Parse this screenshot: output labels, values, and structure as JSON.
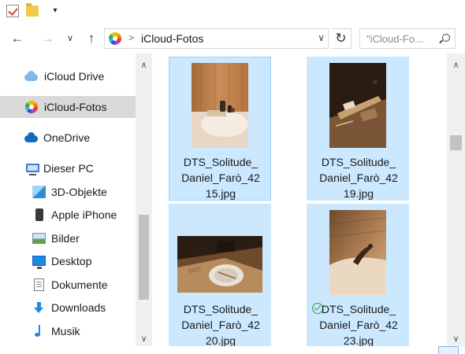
{
  "toolbar": {
    "quick_access": [
      {
        "icon": "properties-check-icon"
      },
      {
        "icon": "new-folder-icon"
      },
      {
        "icon": "customize-dropdown-icon",
        "glyph": "▾"
      }
    ]
  },
  "navigation": {
    "back_glyph": "←",
    "forward_glyph": "→",
    "recent_glyph": "∨",
    "up_glyph": "↑",
    "address": {
      "icon": "icloud-photos-icon",
      "separator": ">",
      "path": "iCloud-Fotos",
      "dropdown_glyph": "∨"
    },
    "refresh_glyph": "↻",
    "search_placeholder": "\"iCloud-Fo..."
  },
  "sidebar": {
    "items": [
      {
        "label": "iCloud Drive",
        "icon": "icloud-drive-icon",
        "selected": false
      },
      {
        "label": "iCloud-Fotos",
        "icon": "icloud-photos-icon",
        "selected": true
      },
      {
        "label": "OneDrive",
        "icon": "onedrive-cloud-icon",
        "selected": false
      },
      {
        "label": "Dieser PC",
        "icon": "this-pc-icon",
        "selected": false
      },
      {
        "label": "3D-Objekte",
        "icon": "3d-objects-icon",
        "selected": false
      },
      {
        "label": "Apple iPhone",
        "icon": "iphone-icon",
        "selected": false
      },
      {
        "label": "Bilder",
        "icon": "pictures-icon",
        "selected": false
      },
      {
        "label": "Desktop",
        "icon": "desktop-icon",
        "selected": false
      },
      {
        "label": "Dokumente",
        "icon": "documents-icon",
        "selected": false
      },
      {
        "label": "Downloads",
        "icon": "downloads-icon",
        "selected": false
      },
      {
        "label": "Musik",
        "icon": "music-icon",
        "selected": false
      }
    ],
    "scroll_up": "∧",
    "scroll_down": "∨"
  },
  "files": [
    {
      "name_lines": [
        "DTS_Solitude_",
        "Daniel_Farò_42",
        "15.jpg"
      ],
      "selected": true,
      "focused": true,
      "synced": false
    },
    {
      "name_lines": [
        "DTS_Solitude_",
        "Daniel_Farò_42",
        "19.jpg"
      ],
      "selected": true,
      "focused": false,
      "synced": false
    },
    {
      "name_lines": [
        "DTS_Solitude_",
        "Daniel_Farò_42",
        "20.jpg"
      ],
      "selected": true,
      "focused": false,
      "synced": false
    },
    {
      "name_lines": [
        "DTS_Solitude_",
        "Daniel_Farò_42",
        "23.jpg"
      ],
      "selected": true,
      "focused": false,
      "synced": true
    }
  ],
  "content_scroll": {
    "up": "∧",
    "down": "∨"
  },
  "colors": {
    "selection_fill": "#cce8ff",
    "selection_border": "#99d1ff",
    "sidebar_selected": "#d9d9d9",
    "sync_green": "#2e9b47"
  }
}
